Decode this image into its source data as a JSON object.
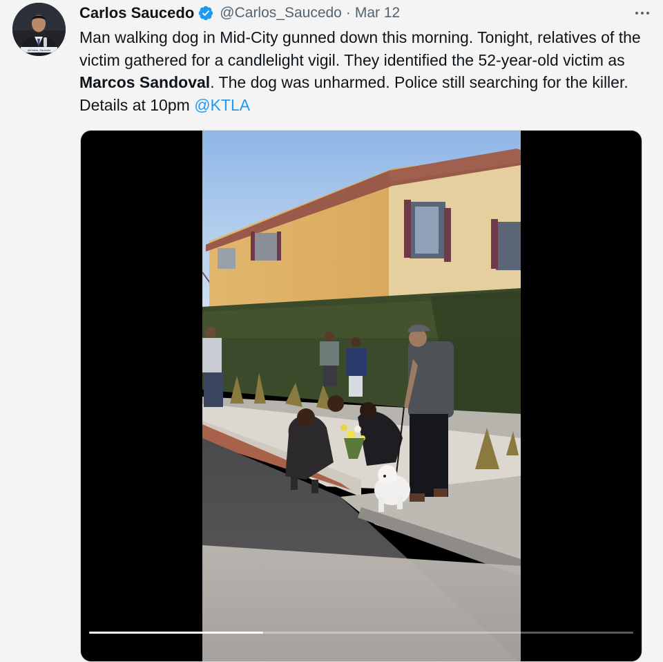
{
  "author": {
    "name": "Carlos Saucedo",
    "handle": "@Carlos_Saucedo",
    "separator": "·",
    "date": "Mar 12",
    "verified": true,
    "avatar_caption": "@Carlos_Saucedo"
  },
  "tweet": {
    "text_part1": "Man walking dog in Mid-City gunned down this morning. Tonight, relatives of the victim gathered for a candlelight vigil. They identified the 52-year-old victim as ",
    "victim_name": "Marcos Sandoval",
    "text_part2": ". The dog was unharmed. Police still searching for the killer. Details at 10pm ",
    "mention": "@KTLA"
  },
  "video": {
    "progress": 0.32
  },
  "icons": {
    "verified": "verified-badge-icon",
    "more": "more-options-icon"
  },
  "colors": {
    "accent": "#1d9bf0",
    "secondary_text": "#536471"
  }
}
